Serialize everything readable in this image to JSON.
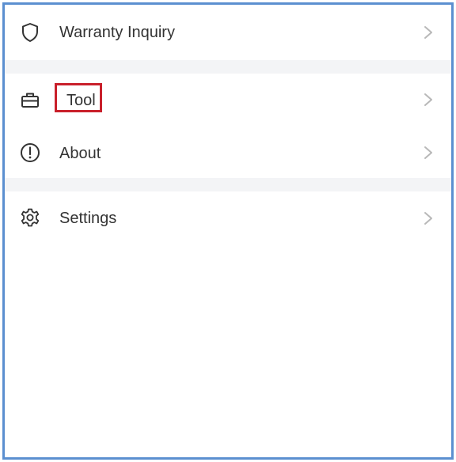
{
  "menu": {
    "items": [
      {
        "label": "Warranty Inquiry",
        "icon": "shield-icon"
      },
      {
        "label": "Tool",
        "icon": "toolbox-icon"
      },
      {
        "label": "About",
        "icon": "info-circle-icon"
      },
      {
        "label": "Settings",
        "icon": "gear-icon"
      }
    ],
    "chevron_icon": "chevron-right-icon",
    "highlighted_item": "Tool"
  },
  "colors": {
    "frame_border": "#5b8fd0",
    "highlight_border": "#c9202b",
    "separator": "#f3f4f6",
    "text": "#333333",
    "icon": "#333333",
    "chevron": "#b8b8b8"
  }
}
